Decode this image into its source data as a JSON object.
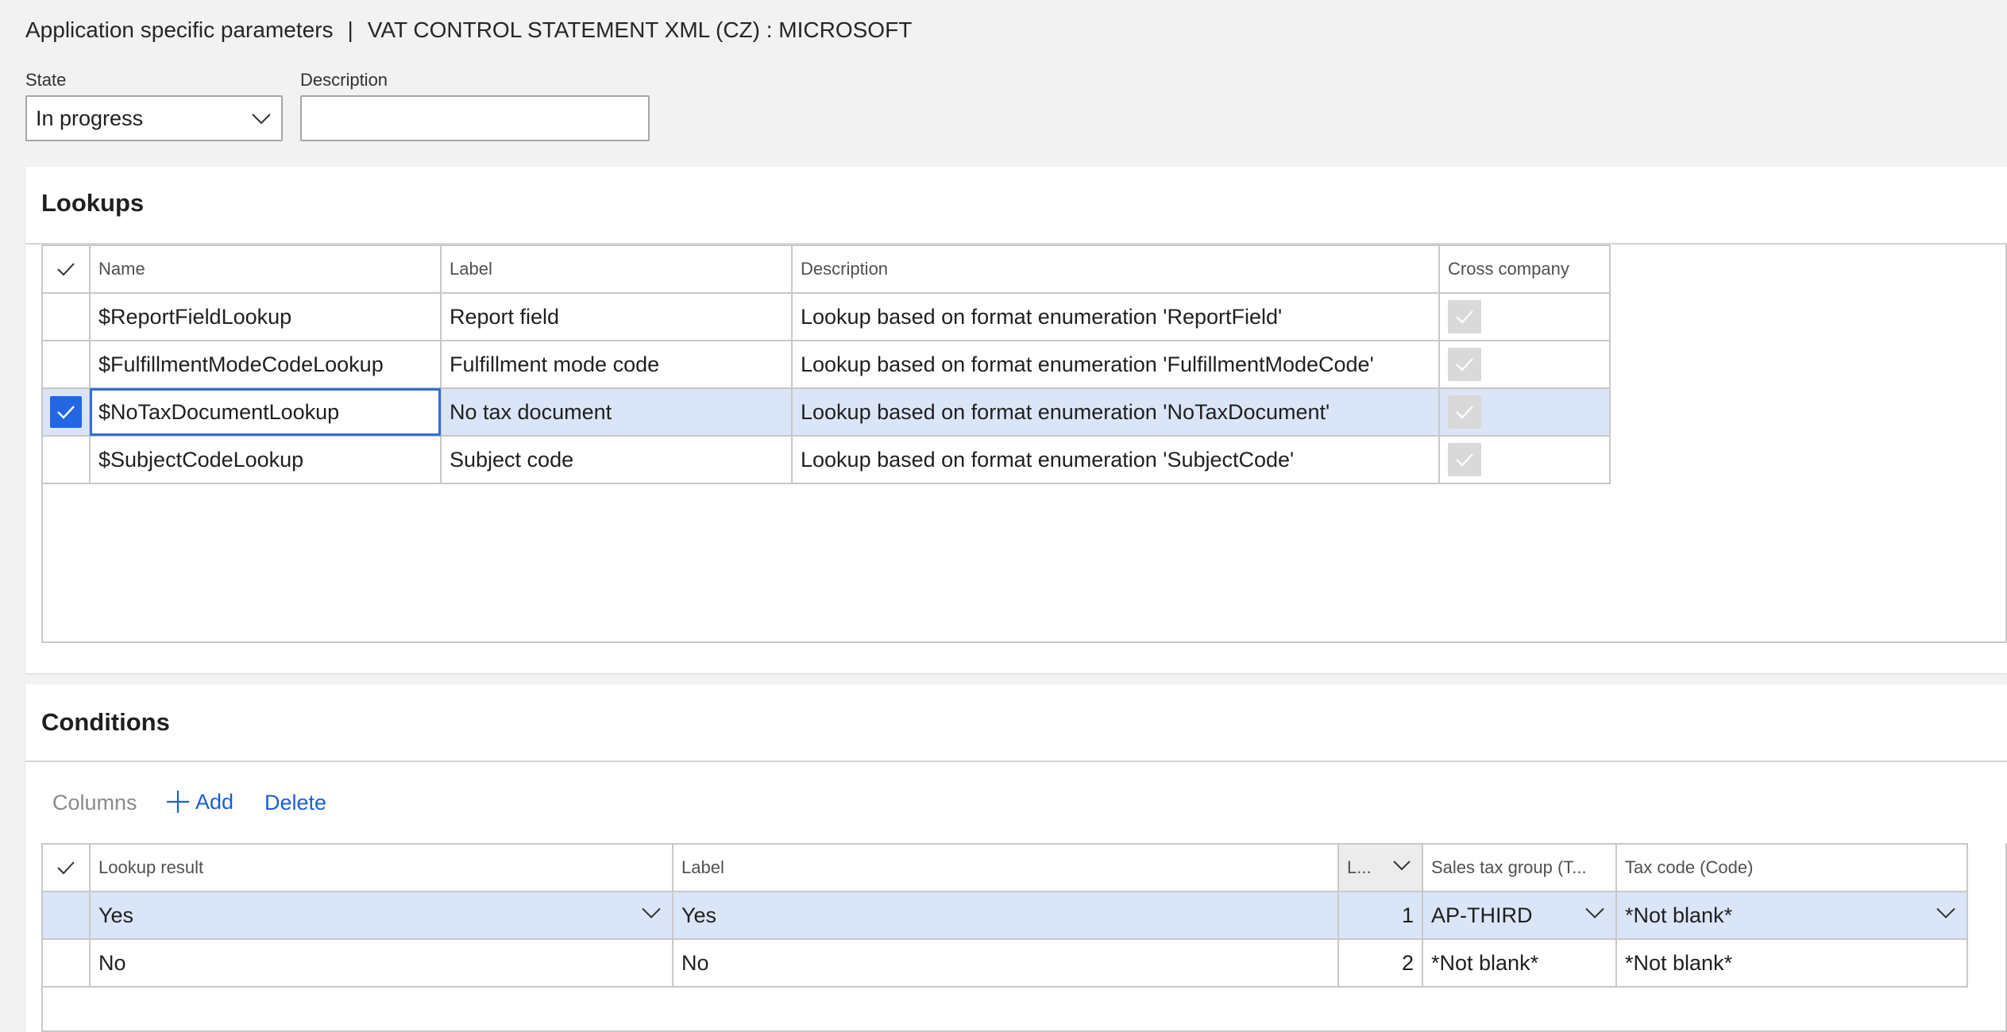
{
  "header": {
    "title_left": "Application specific parameters",
    "separator": "|",
    "title_right": "VAT CONTROL STATEMENT XML (CZ) : MICROSOFT"
  },
  "form": {
    "state_label": "State",
    "state_value": "In progress",
    "description_label": "Description",
    "description_value": ""
  },
  "lookups": {
    "title": "Lookups",
    "columns": [
      "Name",
      "Label",
      "Description",
      "Cross company"
    ],
    "rows": [
      {
        "name": "$ReportFieldLookup",
        "label": "Report field",
        "description": "Lookup based on format enumeration 'ReportField'",
        "cross_company": true,
        "selected": false
      },
      {
        "name": "$FulfillmentModeCodeLookup",
        "label": "Fulfillment mode code",
        "description": "Lookup based on format enumeration 'FulfillmentModeCode'",
        "cross_company": true,
        "selected": false
      },
      {
        "name": "$NoTaxDocumentLookup",
        "label": "No tax document",
        "description": "Lookup based on format enumeration 'NoTaxDocument'",
        "cross_company": true,
        "selected": true
      },
      {
        "name": "$SubjectCodeLookup",
        "label": "Subject code",
        "description": "Lookup based on format enumeration 'SubjectCode'",
        "cross_company": true,
        "selected": false
      }
    ]
  },
  "conditions": {
    "title": "Conditions",
    "toolbar": {
      "columns": "Columns",
      "add": "Add",
      "delete": "Delete"
    },
    "columns": [
      "Lookup result",
      "Label",
      "L...",
      "Sales tax group (T...",
      "Tax code (Code)"
    ],
    "rows": [
      {
        "lookup_result": "Yes",
        "label": "Yes",
        "line": "1",
        "sales_tax_group": "AP-THIRD",
        "tax_code": "*Not blank*",
        "selected": true
      },
      {
        "lookup_result": "No",
        "label": "No",
        "line": "2",
        "sales_tax_group": "*Not blank*",
        "tax_code": "*Not blank*",
        "selected": false
      }
    ]
  },
  "colors": {
    "accent": "#2266e3",
    "selected_row": "#dbe5f8",
    "link": "#1a5fd4"
  }
}
